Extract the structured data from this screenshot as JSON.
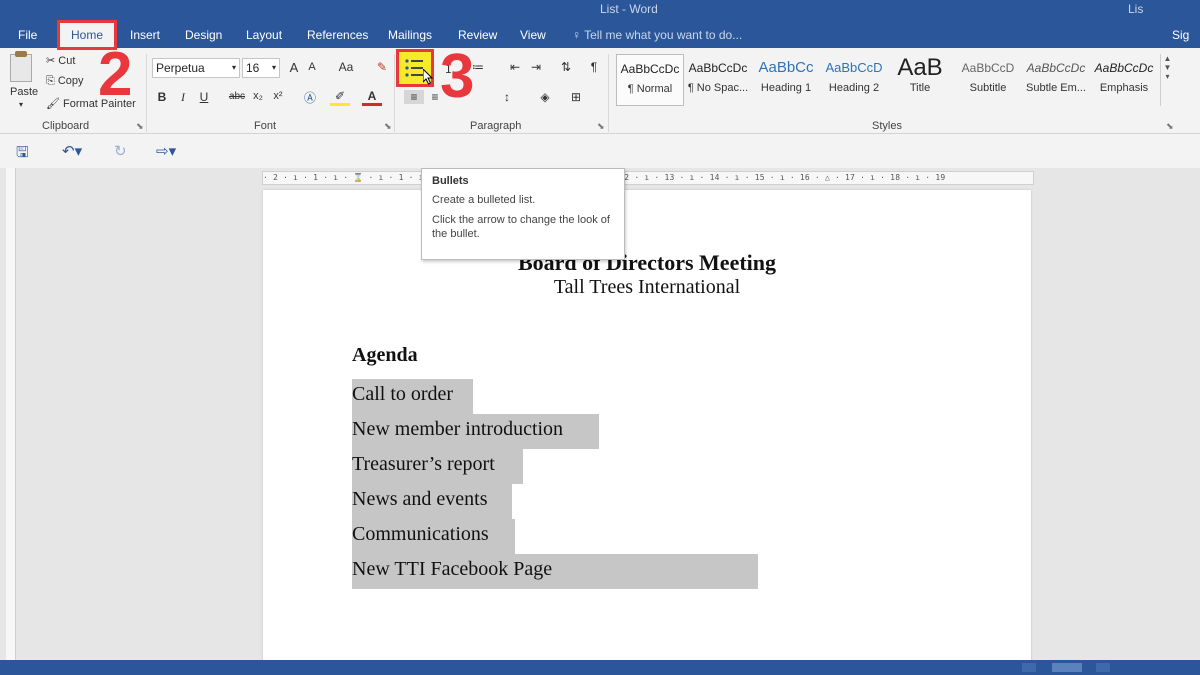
{
  "window": {
    "title": "List - Word",
    "title_right": "Lis"
  },
  "tabs": [
    "File",
    "Home",
    "Insert",
    "Design",
    "Layout",
    "References",
    "Mailings",
    "Review",
    "View"
  ],
  "tell_me": "Tell me what you want to do...",
  "sign_in": "Sig",
  "clipboard": {
    "paste": "Paste",
    "cut": "Cut",
    "copy": "Copy",
    "format_painter": "Format Painter",
    "label": "Clipboard"
  },
  "font": {
    "name": "Perpetua",
    "size": "16",
    "bold": "B",
    "italic": "I",
    "underline": "U",
    "strike": "abc",
    "sub": "x₂",
    "sup": "x²",
    "grow": "A",
    "shrink": "A",
    "case": "Aa",
    "label": "Font"
  },
  "paragraph": {
    "label": "Paragraph",
    "pilcrow": "¶"
  },
  "styles": {
    "label": "Styles",
    "items": [
      {
        "sample": "AaBbCcDc",
        "name": "¶ Normal"
      },
      {
        "sample": "AaBbCcDc",
        "name": "¶ No Spac..."
      },
      {
        "sample": "AaBbCc",
        "name": "Heading 1"
      },
      {
        "sample": "AaBbCcD",
        "name": "Heading 2"
      },
      {
        "sample": "AaB",
        "name": "Title"
      },
      {
        "sample": "AaBbCcD",
        "name": "Subtitle"
      },
      {
        "sample": "AaBbCcDc",
        "name": "Subtle Em..."
      },
      {
        "sample": "AaBbCcDc",
        "name": "Emphasis"
      }
    ]
  },
  "ruler": "· 2 · ı · 1 · ı · ⌛ · ı · 1 · ı ·                                    · 8 · ı · 9 · ı · 10 · ı · 11 · ı · 12 · ı · 13 · ı · 14 · ı · 15 · ı · 16 · △ · 17 · ı · 18 · ı · 19",
  "tooltip": {
    "title": "Bullets",
    "line1": "Create a bulleted list.",
    "line2": "Click the arrow to change the look of the bullet."
  },
  "document": {
    "title": "Board of Directors Meeting",
    "subtitle": "Tall Trees International",
    "agenda_heading": "Agenda",
    "items": [
      "Call to order",
      "New member introduction",
      "Treasurer’s report",
      "News and events",
      "Communications",
      "New TTI Facebook Page"
    ]
  },
  "annotations": {
    "step_home": "2",
    "step_bullets": "3"
  },
  "colors": {
    "brand": "#2b579a",
    "annotation": "#e8383d",
    "highlight": "#f6ea2a",
    "selection": "#c6c6c6"
  }
}
